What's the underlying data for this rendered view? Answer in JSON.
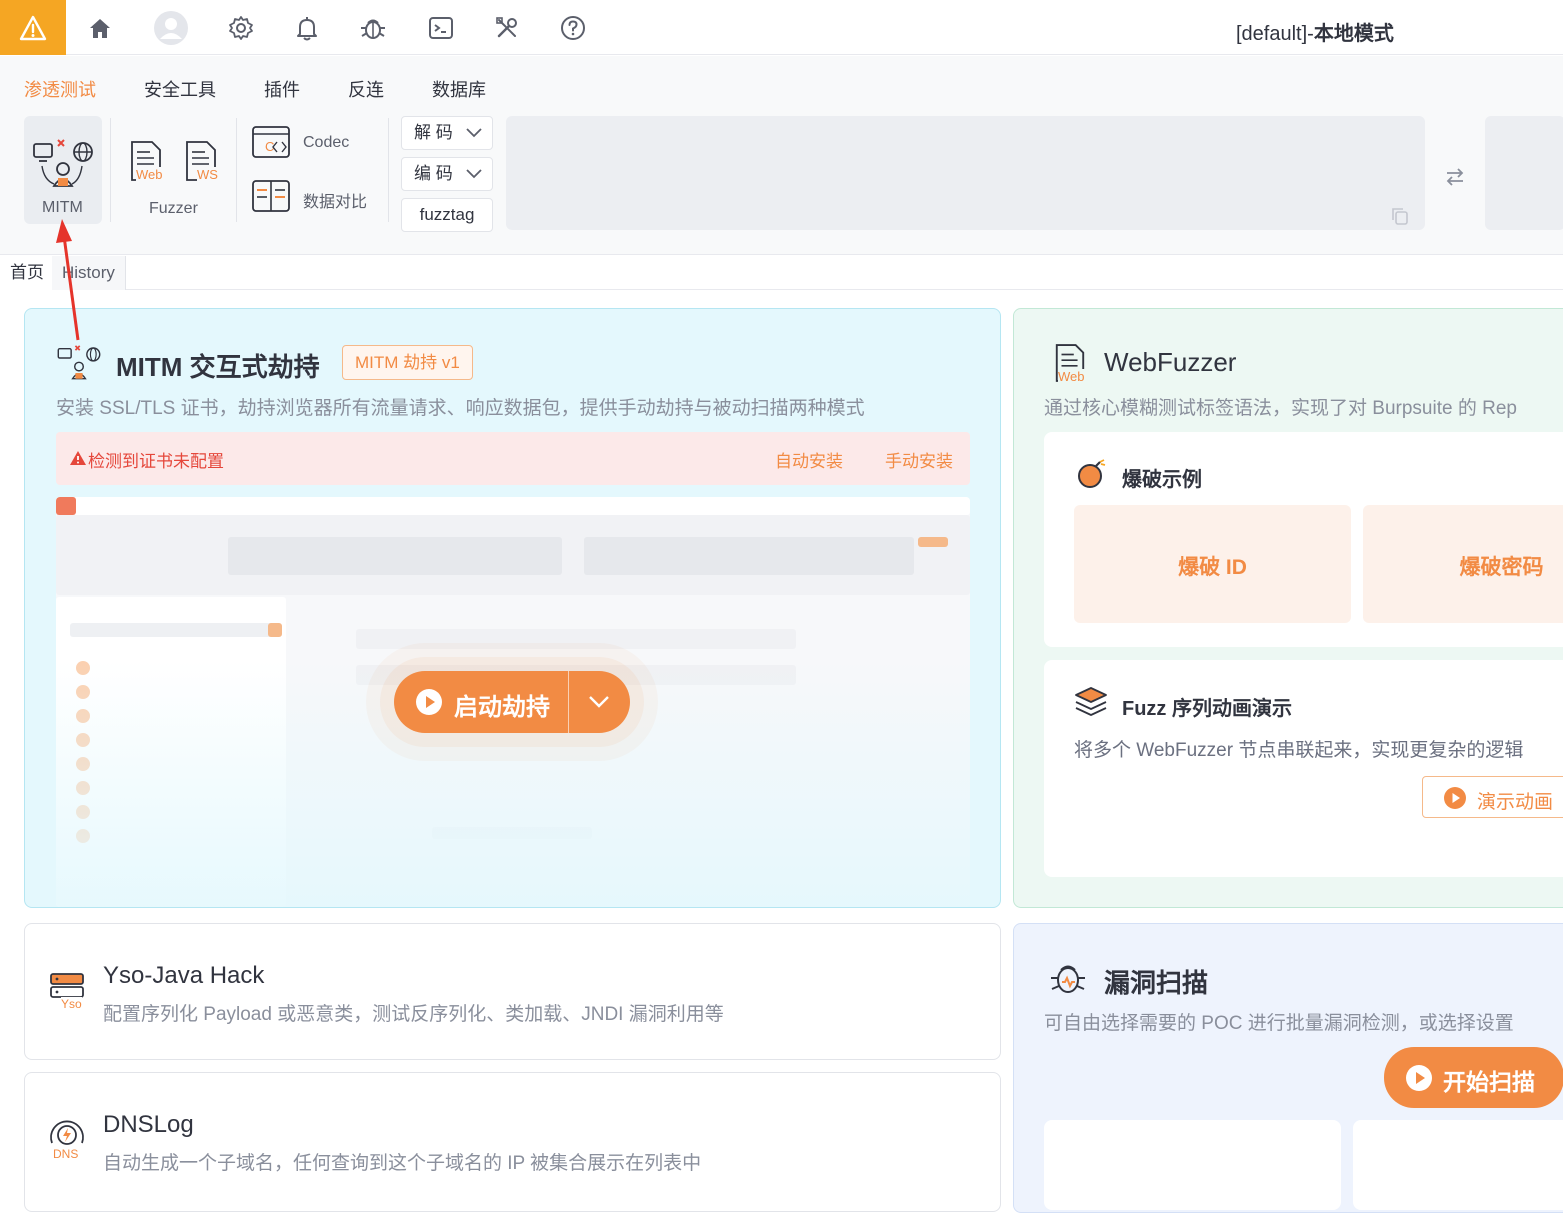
{
  "topbar": {
    "mode_prefix": "[default]-",
    "mode_name": "本地模式",
    "icons": [
      "warning-icon",
      "home-icon",
      "avatar",
      "settings-icon",
      "bell-icon",
      "bug-icon",
      "terminal-icon",
      "tools-icon",
      "help-icon"
    ]
  },
  "nav": {
    "tabs": [
      {
        "label": "渗透测试",
        "active": true
      },
      {
        "label": "安全工具",
        "active": false
      },
      {
        "label": "插件",
        "active": false
      },
      {
        "label": "反连",
        "active": false
      },
      {
        "label": "数据库",
        "active": false
      }
    ]
  },
  "toolbar": {
    "mitm_label": "MITM",
    "fuzzer_label": "Fuzzer",
    "web_tag": "Web",
    "ws_tag": "WS",
    "codec_label": "Codec",
    "compare_label": "数据对比",
    "decode_label": "解 码",
    "encode_label": "编 码",
    "fuzztag_label": "fuzztag"
  },
  "pagetabs": [
    {
      "label": "首页",
      "active": true
    },
    {
      "label": "History",
      "active": false
    }
  ],
  "mitm_card": {
    "title": "MITM 交互式劫持",
    "badge": "MITM 劫持 v1",
    "desc": "安装 SSL/TLS 证书，劫持浏览器所有流量请求、响应数据包，提供手动劫持与被动扫描两种模式",
    "alert": "检测到证书未配置",
    "auto_install": "自动安装",
    "manual_install": "手动安装",
    "start_button": "启动劫持"
  },
  "webfuzzer_card": {
    "title": "WebFuzzer",
    "desc": "通过核心模糊测试标签语法，实现了对 Burpsuite 的 Rep",
    "burst_section": "爆破示例",
    "burst_id": "爆破 ID",
    "burst_pwd": "爆破密码",
    "sequence_title": "Fuzz 序列动画演示",
    "sequence_desc": "将多个 WebFuzzer 节点串联起来，实现更复杂的逻辑",
    "demo_button": "演示动画"
  },
  "yso_card": {
    "title": "Yso-Java Hack",
    "desc": "配置序列化 Payload 或恶意类，测试反序列化、类加载、JNDI 漏洞利用等",
    "icon_tag": "Yso"
  },
  "dns_card": {
    "title": "DNSLog",
    "desc": "自动生成一个子域名，任何查询到这个子域名的 IP 被集合展示在列表中",
    "icon_tag": "DNS"
  },
  "scan_card": {
    "title": "漏洞扫描",
    "desc": "可自由选择需要的 POC 进行批量漏洞检测，或选择设置",
    "scan_button": "开始扫描"
  },
  "colors": {
    "accent": "#f28b44",
    "warning": "#f5a623",
    "error": "#e5473b"
  }
}
